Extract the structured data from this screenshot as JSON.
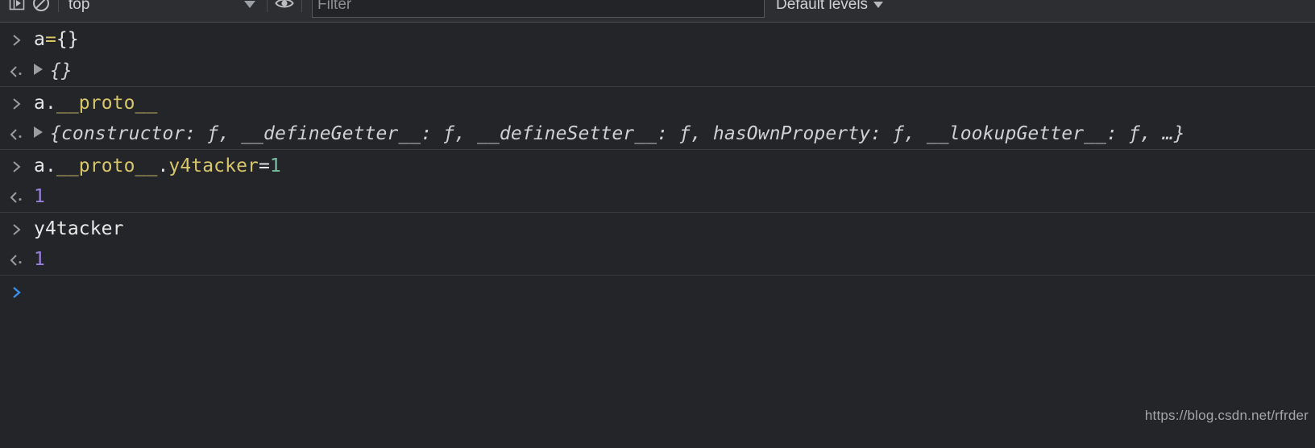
{
  "toolbar": {
    "execution_context_icon": "frame-play-icon",
    "clear_console_icon": "clear-console-icon",
    "context_selected": "top",
    "context_caret_icon": "chevron-down-icon",
    "live_expression_icon": "eye-icon",
    "filter_placeholder": "Filter",
    "filter_value": "",
    "levels_label": "Default levels",
    "levels_caret_icon": "chevron-down-icon"
  },
  "console": {
    "entries": [
      {
        "kind": "input",
        "prompt": ">",
        "tokens": [
          {
            "text": "a",
            "color": "plain"
          },
          {
            "text": "=",
            "color": "op"
          },
          {
            "text": "{}",
            "color": "plain"
          }
        ],
        "plain": "a={}"
      },
      {
        "kind": "output",
        "prompt": "‹·",
        "expandable": true,
        "value": "{}",
        "italic": false
      },
      {
        "kind": "input",
        "prompt": ">",
        "tokens": [
          {
            "text": "a.",
            "color": "plain"
          },
          {
            "text": "__proto__",
            "color": "prop"
          }
        ],
        "plain": "a.__proto__"
      },
      {
        "kind": "output",
        "prompt": "‹·",
        "expandable": true,
        "value": "{constructor: ƒ, __defineGetter__: ƒ, __defineSetter__: ƒ, hasOwnProperty: ƒ, __lookupGetter__: ƒ, …}",
        "italic": true
      },
      {
        "kind": "input",
        "prompt": ">",
        "tokens": [
          {
            "text": "a.",
            "color": "plain"
          },
          {
            "text": "__proto__",
            "color": "prop"
          },
          {
            "text": ".",
            "color": "plain"
          },
          {
            "text": "y4tacker",
            "color": "prop"
          },
          {
            "text": "=",
            "color": "opw"
          },
          {
            "text": "1",
            "color": "num"
          }
        ],
        "plain": "a.__proto__.y4tacker=1"
      },
      {
        "kind": "output",
        "prompt": "‹·",
        "expandable": false,
        "value": "1",
        "result_number": true
      },
      {
        "kind": "input",
        "prompt": ">",
        "tokens": [
          {
            "text": "y4tacker",
            "color": "plain"
          }
        ],
        "plain": "y4tacker"
      },
      {
        "kind": "output",
        "prompt": "‹·",
        "expandable": false,
        "value": "1",
        "result_number": true
      }
    ],
    "active_prompt": ">"
  },
  "watermark": "https://blog.csdn.net/rfrder",
  "colors": {
    "background": "#242528",
    "toolbar_background": "#2d2e31",
    "separator": "#3a3b3e",
    "text": "#e8e8e8",
    "property": "#d8c66b",
    "number": "#79c0a0",
    "result": "#9a7fe0",
    "prompt_active": "#3b8eea",
    "prompt_muted": "#9b9c9f"
  }
}
